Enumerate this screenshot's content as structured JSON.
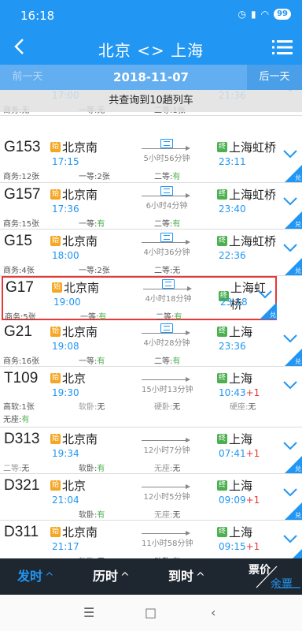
{
  "status": {
    "time": "16:18",
    "battery": "99"
  },
  "header": {
    "title": "北京 <> 上海"
  },
  "date_bar": {
    "prev": "前一天",
    "date": "2018-11-07",
    "next": "后一天"
  },
  "overlay_text": "共查询到10趟列车",
  "trains": [
    {
      "num": "G13",
      "from": "北京南",
      "from_tag": "始",
      "to": "上海虹桥",
      "to_tag": "终",
      "dep": "17:00",
      "arr": "21:36",
      "duration": "",
      "has_ticket_icon": false,
      "seats": [
        {
          "label": "商务:",
          "value": "无"
        },
        {
          "label": "一等:",
          "value": "无"
        },
        {
          "label": "二等:",
          "value": "1张"
        }
      ],
      "corner": ""
    },
    {
      "num": "G153",
      "from": "北京南",
      "from_tag": "始",
      "to": "上海虹桥",
      "to_tag": "终",
      "dep": "17:15",
      "arr": "23:11",
      "duration": "5小时56分钟",
      "has_ticket_icon": true,
      "seats": [
        {
          "label": "商务:",
          "value": "12张"
        },
        {
          "label": "一等:",
          "value": "2张"
        },
        {
          "label": "二等:",
          "value": "有"
        }
      ],
      "corner": "兑"
    },
    {
      "num": "G157",
      "from": "北京南",
      "from_tag": "始",
      "to": "上海虹桥",
      "to_tag": "终",
      "dep": "17:36",
      "arr": "23:40",
      "duration": "6小时4分钟",
      "has_ticket_icon": true,
      "seats": [
        {
          "label": "商务:",
          "value": "15张"
        },
        {
          "label": "一等:",
          "value": "有"
        },
        {
          "label": "二等:",
          "value": "有"
        }
      ],
      "corner": "兑"
    },
    {
      "num": "G15",
      "from": "北京南",
      "from_tag": "始",
      "to": "上海虹桥",
      "to_tag": "终",
      "dep": "18:00",
      "arr": "22:36",
      "duration": "4小时36分钟",
      "has_ticket_icon": true,
      "seats": [
        {
          "label": "商务:",
          "value": "4张"
        },
        {
          "label": "一等:",
          "value": "2张"
        },
        {
          "label": "二等:",
          "value": "无"
        }
      ],
      "corner": "兑"
    },
    {
      "num": "G17",
      "from": "北京南",
      "from_tag": "始",
      "to": "上海虹桥",
      "to_tag": "终",
      "dep": "19:00",
      "arr": "23:18",
      "duration": "4小时18分钟",
      "has_ticket_icon": true,
      "seats": [
        {
          "label": "商务:",
          "value": "5张"
        },
        {
          "label": "一等:",
          "value": "有"
        },
        {
          "label": "二等:",
          "value": "有"
        }
      ],
      "corner": "兑"
    },
    {
      "num": "G21",
      "from": "北京南",
      "from_tag": "始",
      "to": "上海",
      "to_tag": "终",
      "dep": "19:08",
      "arr": "23:36",
      "duration": "4小时28分钟",
      "has_ticket_icon": true,
      "seats": [
        {
          "label": "商务:",
          "value": "16张"
        },
        {
          "label": "一等:",
          "value": "有"
        },
        {
          "label": "二等:",
          "value": "有"
        }
      ],
      "corner": "兑"
    },
    {
      "num": "T109",
      "from": "北京",
      "from_tag": "始",
      "to": "上海",
      "to_tag": "终",
      "dep": "19:30",
      "arr": "10:43",
      "arr_plus": "+1",
      "duration": "15小时13分钟",
      "has_ticket_icon": false,
      "seats": [
        {
          "label": "高软:",
          "value": "1张"
        },
        {
          "label": "软卧:",
          "value": "无"
        },
        {
          "label": "硬卧:",
          "value": "无"
        },
        {
          "label": "硬座:",
          "value": "无"
        },
        {
          "label": "无座:",
          "value": "有"
        }
      ],
      "corner": ""
    },
    {
      "num": "D313",
      "from": "北京南",
      "from_tag": "始",
      "to": "上海",
      "to_tag": "终",
      "dep": "19:34",
      "arr": "07:41",
      "arr_plus": "+1",
      "duration": "12小时7分钟",
      "has_ticket_icon": false,
      "seats": [
        {
          "label": "二等:",
          "value": "无"
        },
        {
          "label": "软卧:",
          "value": "有"
        },
        {
          "label": "无座:",
          "value": "无"
        }
      ],
      "corner": "兑"
    },
    {
      "num": "D321",
      "from": "北京",
      "from_tag": "始",
      "to": "上海",
      "to_tag": "终",
      "dep": "21:04",
      "arr": "09:09",
      "arr_plus": "+1",
      "duration": "12小时5分钟",
      "has_ticket_icon": false,
      "seats": [
        {
          "label": "软卧:",
          "value": "有"
        },
        {
          "label": "无座:",
          "value": "无"
        }
      ],
      "corner": "兑"
    },
    {
      "num": "D311",
      "from": "北京南",
      "from_tag": "始",
      "to": "上海",
      "to_tag": "终",
      "dep": "21:17",
      "arr": "09:15",
      "arr_plus": "+1",
      "duration": "11小时58分钟",
      "has_ticket_icon": false,
      "seats": [
        {
          "label": "软卧:",
          "value": "无"
        },
        {
          "label": "动卧:",
          "value": "有"
        }
      ],
      "corner": "兑"
    }
  ],
  "bottom_tabs": [
    {
      "label": "发时",
      "caret": "^"
    },
    {
      "label": "历时",
      "caret": "^"
    },
    {
      "label": "到时",
      "caret": "^"
    }
  ],
  "price_toggle": {
    "top": "票价",
    "bottom": "余票"
  },
  "nav": {
    "menu": "☰",
    "home": "□",
    "back": "‹"
  },
  "colors": {
    "primary": "#2196f3",
    "available": "#4caf50",
    "highlight": "#e53935"
  }
}
